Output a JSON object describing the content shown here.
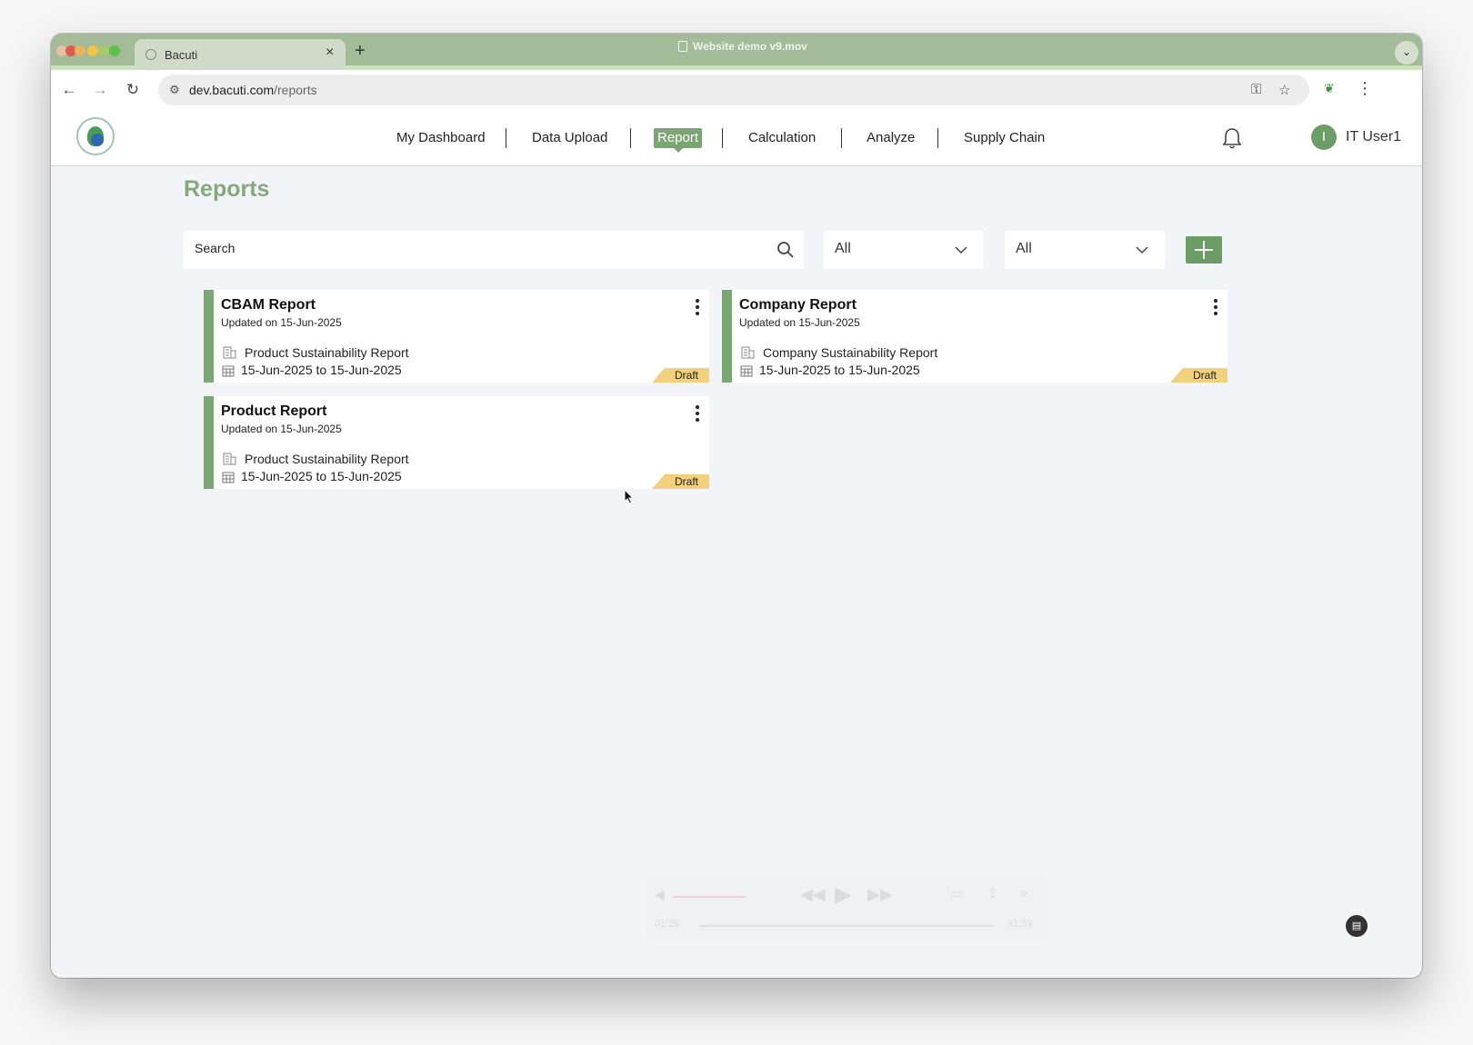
{
  "browser": {
    "tab_title": "Bacuti",
    "video_title": "Website demo v9.mov",
    "url_host": "dev.bacuti.com",
    "url_path": "/reports"
  },
  "nav": {
    "items": [
      {
        "label": "My Dashboard",
        "active": false
      },
      {
        "label": "Data Upload",
        "active": false
      },
      {
        "label": "Report",
        "active": true
      },
      {
        "label": "Calculation",
        "active": false
      },
      {
        "label": "Analyze",
        "active": false
      },
      {
        "label": "Supply Chain",
        "active": false
      }
    ],
    "avatar_initial": "I",
    "user_name": "IT User1"
  },
  "page": {
    "title": "Reports",
    "search_placeholder": "Search",
    "filter1_value": "All",
    "filter2_value": "All"
  },
  "cards": [
    {
      "title": "CBAM Report",
      "updated": "Updated on 15-Jun-2025",
      "type": "Product Sustainability Report",
      "dates": "15-Jun-2025 to 15-Jun-2025",
      "status": "Draft"
    },
    {
      "title": "Company Report",
      "updated": "Updated on 15-Jun-2025",
      "type": "Company Sustainability Report",
      "dates": "15-Jun-2025 to 15-Jun-2025",
      "status": "Draft"
    },
    {
      "title": "Product Report",
      "updated": "Updated on 15-Jun-2025",
      "type": "Product Sustainability Report",
      "dates": "15-Jun-2025 to 15-Jun-2025",
      "status": "Draft"
    }
  ],
  "player": {
    "elapsed": "01:29",
    "remaining": "01:59"
  },
  "colors": {
    "brand_green": "#7ba574",
    "title_green": "#86a87d",
    "draft_yellow": "#f1d07e"
  }
}
